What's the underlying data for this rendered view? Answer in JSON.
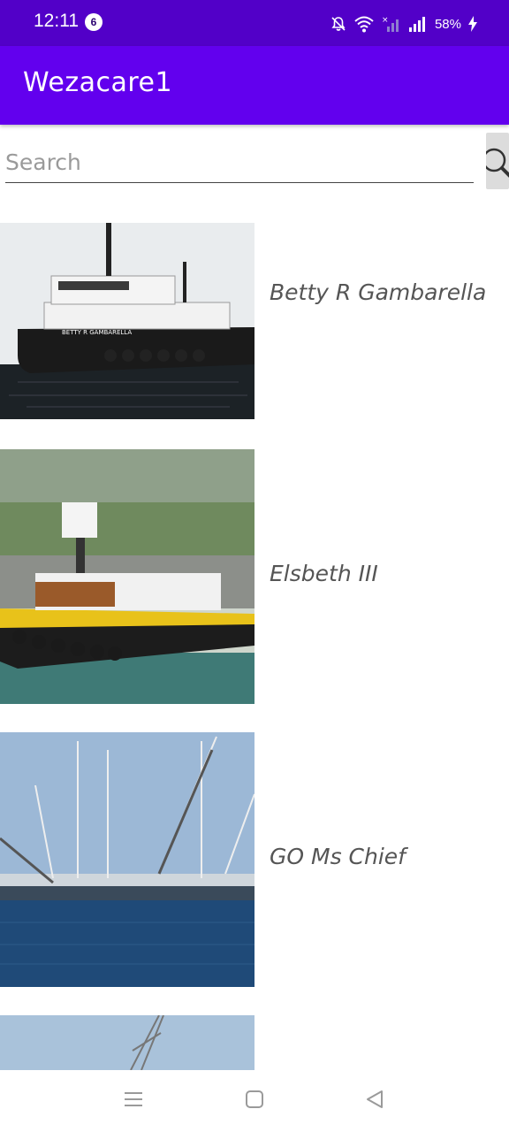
{
  "status_bar": {
    "time": "12:11",
    "notification_count": "6",
    "battery": "58%"
  },
  "app_bar": {
    "title": "Wezacare1"
  },
  "search": {
    "placeholder": "Search"
  },
  "vessels": [
    {
      "name": "Betty R Gambarella",
      "hull_text": "BETTY R GAMBARELLA"
    },
    {
      "name": "Elsbeth III"
    },
    {
      "name": "GO Ms Chief"
    },
    {
      "name": ""
    }
  ],
  "colors": {
    "status_bar": "#5200c8",
    "app_bar": "#6200ee",
    "text_gray": "#555555"
  }
}
